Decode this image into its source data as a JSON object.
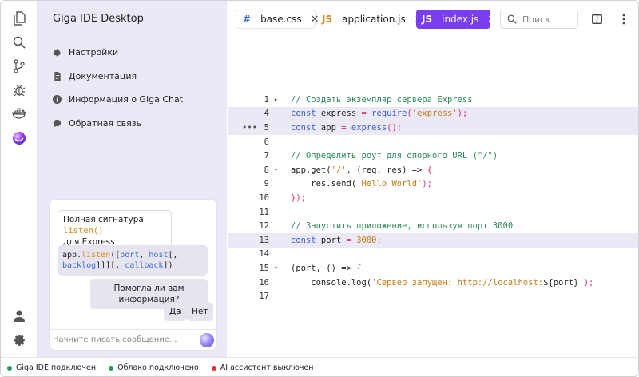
{
  "app": {
    "title": "Giga IDE Desktop"
  },
  "activity_bar": {
    "top_icons": [
      "files-icon",
      "search-icon",
      "source-control-icon",
      "debug-icon",
      "docker-icon",
      "giga-chat-icon"
    ],
    "bottom_icons": [
      "account-icon",
      "settings-icon"
    ]
  },
  "sidebar": {
    "items": [
      {
        "label": "Настройки",
        "icon": "gear-icon"
      },
      {
        "label": "Документация",
        "icon": "document-icon"
      },
      {
        "label": "Информация о Giga Chat",
        "icon": "info-icon"
      },
      {
        "label": "Обратная связь",
        "icon": "chat-bubble-icon"
      }
    ]
  },
  "chat": {
    "msg1_text": "Полная сигнатура ",
    "msg1_code": "listen()",
    "msg1_tail": "для Express",
    "msg2": {
      "p1": "app.",
      "p2": "listen",
      "p3": "([",
      "p4": "port",
      "p5": ", ",
      "p6": "host",
      "p7": "[,",
      "p8": "backlog",
      "p9": "]]][, ",
      "p10": "callback",
      "p11": "])"
    },
    "question": "Помогла ли вам информация?",
    "yes_label": "Да",
    "no_label": "Нет",
    "input_placeholder": "Начните писать сообщение..."
  },
  "tabs": [
    {
      "icon": "#",
      "label": "base.css"
    },
    {
      "icon": "JS",
      "label": "application.js"
    },
    {
      "icon": "JS",
      "label": "index.js",
      "active": true
    }
  ],
  "search": {
    "placeholder": "Поиск"
  },
  "editor": {
    "lines": [
      {
        "num": "1",
        "fold": "▸",
        "com": "// Создать экземпляр сервера Express"
      },
      {
        "num": "4",
        "a": "const",
        "b": " express ",
        "c": "=",
        "d": " require",
        "e": "(",
        "f": "'express'",
        "g": ");",
        "highlight": true
      },
      {
        "num": "5",
        "a": "const",
        "b": " app ",
        "c": "=",
        "d": " express",
        "e": "();",
        "highlight": true,
        "dots": "•••"
      },
      {
        "num": "6"
      },
      {
        "num": "7",
        "com": "// Определить роут для опорного URL (\"/\")"
      },
      {
        "num": "8",
        "fold": "▾",
        "a": "app.get(",
        "b": "'/'",
        "c": ", (req, res) ",
        "d": "=>",
        "e": " {"
      },
      {
        "num": "9",
        "a": "    res.send(",
        "b": "'Hello World'",
        "c": ");"
      },
      {
        "num": "10",
        "a": "});"
      },
      {
        "num": "11"
      },
      {
        "num": "12",
        "com": "// Запустить приложение, используя порт 3000"
      },
      {
        "num": "13",
        "a": "const",
        "b": " port ",
        "c": "=",
        "d": " 3000",
        "e": ";",
        "highlight": true
      },
      {
        "num": "14"
      },
      {
        "num": "15",
        "fold": "▾",
        "a": "(port, () ",
        "b": "=>",
        "c": " {"
      },
      {
        "num": "16",
        "a": "    console.log(",
        "b": "'Сервер запущен: http://localhost:",
        "c": "${port}",
        "d": "'",
        "e": ");"
      },
      {
        "num": "17"
      }
    ]
  },
  "status_bar": [
    {
      "label": "Giga IDE подключен",
      "color": "#1f9d55"
    },
    {
      "label": "Облако подключено",
      "color": "#1f9d55"
    },
    {
      "label": "AI ассистент выключен",
      "color": "#e03131"
    }
  ]
}
